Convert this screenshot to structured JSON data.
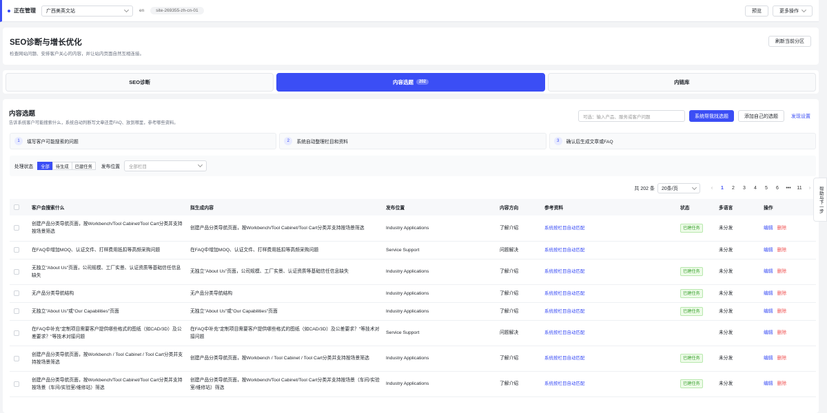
{
  "topbar": {
    "managing_label": "正在管理",
    "site_name": "广西美英文站",
    "lang": "en",
    "site_id": "site-269355-zh-cn-01",
    "preview_label": "预览",
    "more_label": "更多操作"
  },
  "header": {
    "title": "SEO诊断与增长优化",
    "subtitle": "检查网站问题、安排客户关心的内容，并让站内页面自然互相连接。",
    "refresh_label": "刷新当前分区"
  },
  "tabs": [
    {
      "label": "SEO诊断"
    },
    {
      "label": "内容选题",
      "badge": "202"
    },
    {
      "label": "内链库"
    }
  ],
  "section": {
    "title": "内容选题",
    "subtitle": "告诉系统客户可能搜索什么，系统自动判断写文章还是FAQ、放到哪里，参考哪些资料。",
    "input_placeholder": "可选：输入产品、服务或客户问题",
    "find_label": "系统帮我找选题",
    "add_label": "添加自己的选题",
    "settings_label": "发现设置"
  },
  "steps": [
    {
      "num": "1",
      "label": "填写客户可能搜索的问题"
    },
    {
      "num": "2",
      "label": "系统自动整理栏目和资料"
    },
    {
      "num": "3",
      "label": "确认后生成文章或FAQ"
    }
  ],
  "filters": {
    "status_label": "处理状态",
    "status_options": [
      "全部",
      "待生成",
      "已建任务"
    ],
    "position_label": "发布位置",
    "position_placeholder": "全部栏目"
  },
  "pagination": {
    "total": "共 202 条",
    "per_page": "20条/页",
    "pages": [
      "1",
      "2",
      "3",
      "4",
      "5",
      "6",
      "•••",
      "11"
    ],
    "current": "1"
  },
  "table": {
    "headers": [
      "客户会搜索什么",
      "拟生成内容",
      "发布位置",
      "内容方向",
      "参考资料",
      "状态",
      "多语言",
      "操作"
    ],
    "edit_label": "编辑",
    "delete_label": "删除",
    "rows": [
      {
        "query": "创建产品分类导航页面，按Workbench/Tool Cabinet/Tool Cart分类并支持按场景筛选",
        "content": "创建产品分类导航页面，按Workbench/Tool Cabinet/Tool Cart分类并支持按场景筛选",
        "position": "Industry Applications",
        "direction": "了解介绍",
        "ref": "系统按栏目自动匹配",
        "status": "已建任务",
        "lang": "未分发"
      },
      {
        "query": "在FAQ中增加MOQ、认证文件、打样费用抵扣等高频采购问题",
        "content": "在FAQ中增加MOQ、认证文件、打样费用抵扣等高频采购问题",
        "position": "Service Support",
        "direction": "问题解决",
        "ref": "系统按栏目自动匹配",
        "status": "",
        "lang": "未分发"
      },
      {
        "query": "无独立\"About Us\"页面，公司规模、工厂实景、认证资质等基础信任信息缺失",
        "content": "无独立\"About Us\"页面，公司规模、工厂实景、认证资质等基础信任信息缺失",
        "position": "Industry Applications",
        "direction": "了解介绍",
        "ref": "系统按栏目自动匹配",
        "status": "已建任务",
        "lang": "未分发"
      },
      {
        "query": "无产品分类导航结构",
        "content": "无产品分类导航结构",
        "position": "Industry Applications",
        "direction": "了解介绍",
        "ref": "系统按栏目自动匹配",
        "status": "已建任务",
        "lang": "未分发"
      },
      {
        "query": "无独立\"About Us\"或\"Our Capabilities\"页面",
        "content": "无独立\"About Us\"或\"Our Capabilities\"页面",
        "position": "Industry Applications",
        "direction": "了解介绍",
        "ref": "系统按栏目自动匹配",
        "status": "已建任务",
        "lang": "未分发"
      },
      {
        "query": "在FAQ中补充\"定制项目需要客户提供哪些格式的图纸（如CAD/3D）及公差要求？\"等技术对接问题",
        "content": "在FAQ中补充\"定制项目需要客户提供哪些格式的图纸（如CAD/3D）及公差要求？\"等技术对接问题",
        "position": "Service Support",
        "direction": "问题解决",
        "ref": "系统按栏目自动匹配",
        "status": "",
        "lang": "未分发"
      },
      {
        "query": "创建产品分类导航页面，按Workbench / Tool Cabinet / Tool Cart分类并支持按场景筛选",
        "content": "创建产品分类导航页面，按Workbench / Tool Cabinet / Tool Cart分类并支持按场景筛选",
        "position": "Industry Applications",
        "direction": "了解介绍",
        "ref": "系统按栏目自动匹配",
        "status": "已建任务",
        "lang": "未分发"
      },
      {
        "query": "创建产品分类导航页面，按Workbench/Tool Cabinet/Tool Cart分类并支持按场景（车间/实验室/维修站）筛选",
        "content": "创建产品分类导航页面，按Workbench/Tool Cabinet/Tool Cart分类并支持按场景（车间/实验室/维修站）筛选",
        "position": "Industry Applications",
        "direction": "了解介绍",
        "ref": "系统按栏目自动匹配",
        "status": "已建任务",
        "lang": "未分发"
      }
    ]
  },
  "side_help": {
    "label": "帮助与下一步"
  }
}
